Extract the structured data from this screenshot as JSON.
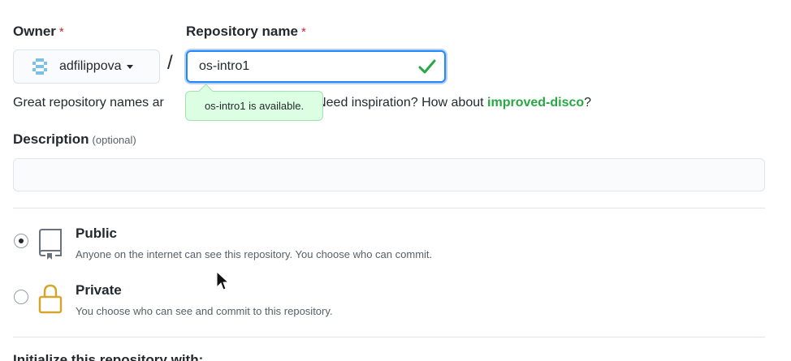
{
  "owner": {
    "label": "Owner",
    "required_mark": "*",
    "selected": "adfilippova"
  },
  "separator": "/",
  "repo": {
    "label": "Repository name",
    "required_mark": "*",
    "value": "os-intro1",
    "status": "valid"
  },
  "tooltip": {
    "text": "os-intro1 is available."
  },
  "helper": {
    "prefix": "Great repository names ar",
    "suffix": "ble. Need inspiration? How about ",
    "suggestion": "improved-disco",
    "end": "?"
  },
  "description": {
    "label": "Description",
    "optional": "(optional)",
    "value": ""
  },
  "visibility": {
    "selected": "public",
    "options": [
      {
        "id": "public",
        "title": "Public",
        "desc": "Anyone on the internet can see this repository. You choose who can commit."
      },
      {
        "id": "private",
        "title": "Private",
        "desc": "You choose who can see and commit to this repository."
      }
    ]
  },
  "initialize": {
    "heading": "Initialize this repository with:"
  },
  "colors": {
    "focus": "#2188ff",
    "success": "#28a745",
    "tooltip_bg": "#dcffe4",
    "lock": "#d4a72c"
  }
}
